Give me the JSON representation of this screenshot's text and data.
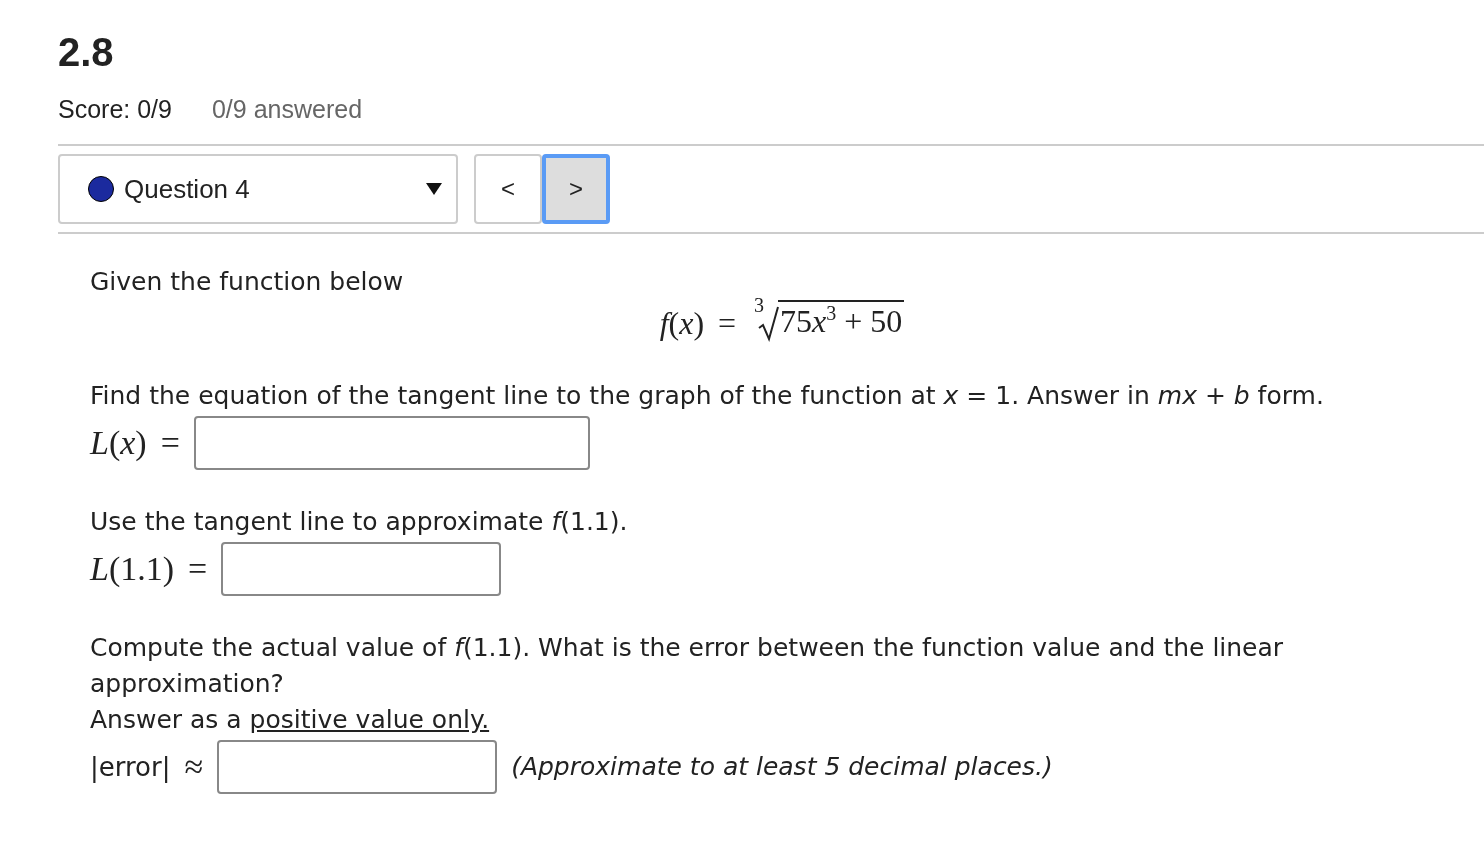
{
  "heading": "2.8",
  "score": "Score: 0/9",
  "answered": "0/9 answered",
  "question_select": {
    "label": "Question 4"
  },
  "nav": [
    {
      "label": "<",
      "focused": false
    },
    {
      "label": ">",
      "focused": true
    }
  ],
  "prompt": "Given the function below",
  "function": {
    "lhs": "*f*(*x*)",
    "relation": "=",
    "root_index": "3",
    "coefficient": "75",
    "variable": "x",
    "power": "3",
    "rest": "+ 50"
  },
  "parts": [
    {
      "kind": "plain",
      "text": "Find the equation of the tangent line to the graph of the function at *x* = 1. Answer in *mx* + *b* form.",
      "label": "*L*(*x*)",
      "relation": "="
    },
    {
      "kind": "plain",
      "text": "Use the tangent line to approximate *f*(1.1).",
      "label": "*L*(1.1)",
      "relation": "="
    },
    {
      "kind": "linked",
      "text": "Compute the actual value of *f*(1.1). What is the error between the function value and the linear approximation?",
      "lead": "Answer as a ",
      "link": "positive value only.",
      "label": "|error|",
      "relation": "≈",
      "hint": "(Approximate to at least 5 decimal places.)"
    }
  ]
}
